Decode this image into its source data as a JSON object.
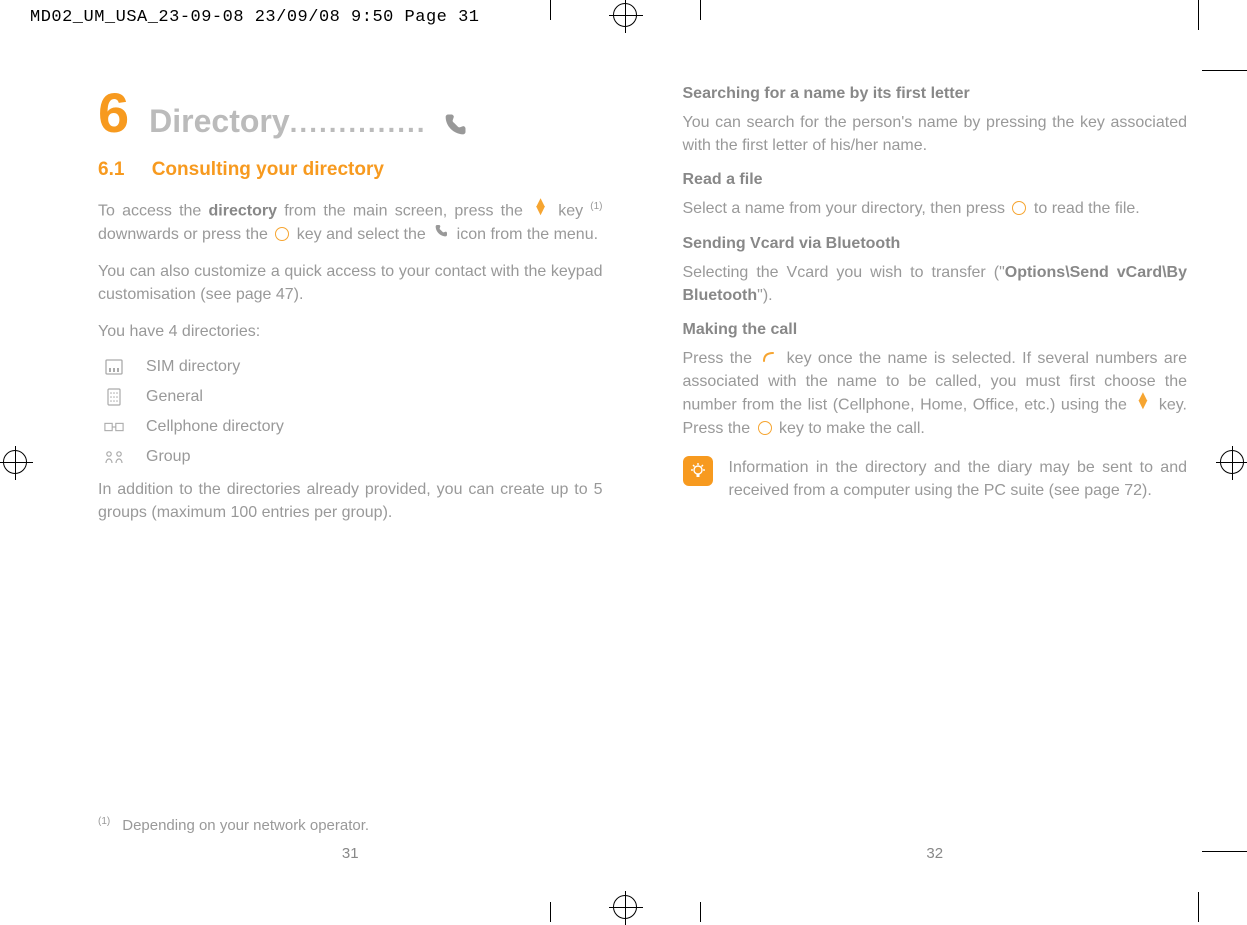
{
  "print_header": "MD02_UM_USA_23-09-08  23/09/08  9:50  Page 31",
  "left": {
    "chapter_num": "6",
    "chapter_title": "Directory",
    "section_num": "6.1",
    "section_title": "Consulting your directory",
    "p1_a": "To access the ",
    "p1_b": "directory",
    "p1_c": " from the main screen, press the ",
    "p1_d": " key ",
    "p1_sup": "(1)",
    "p1_e": " downwards or press the ",
    "p1_f": " key and select the ",
    "p1_g": " icon from the menu.",
    "p2": "You can also customize a quick access to your contact with the keypad customisation (see page 47).",
    "p3": "You have 4 directories:",
    "dirs": {
      "0": "SIM directory",
      "1": "General",
      "2": "Cellphone directory",
      "3": "Group"
    },
    "p4": "In addition to the directories already provided, you can create up to 5 groups (maximum 100 entries per group).",
    "footnote_mark": "(1)",
    "footnote": "Depending on your network operator.",
    "pagenum": "31"
  },
  "right": {
    "h1": "Searching for a name by its first letter",
    "p1": "You can search for the person's name by pressing the key associated with the first letter of his/her name.",
    "h2": "Read a file",
    "p2_a": "Select a name from your directory, then press ",
    "p2_b": " to read the file.",
    "h3": "Sending Vcard via Bluetooth",
    "p3_a": "Selecting the Vcard you wish to transfer (\"",
    "p3_b": "Options\\Send vCard\\By Bluetooth",
    "p3_c": "\").",
    "h4": "Making the call",
    "p4_a": "Press the ",
    "p4_b": " key once the name is selected. If several numbers are associated with the name to be called, you must first choose the number from the list (Cellphone, Home, Office, etc.) using the ",
    "p4_c": " key. Press the ",
    "p4_d": " key to make the call.",
    "tip": "Information in the directory and the diary may be sent to and received from a computer using the PC suite (see page 72).",
    "pagenum": "32"
  }
}
